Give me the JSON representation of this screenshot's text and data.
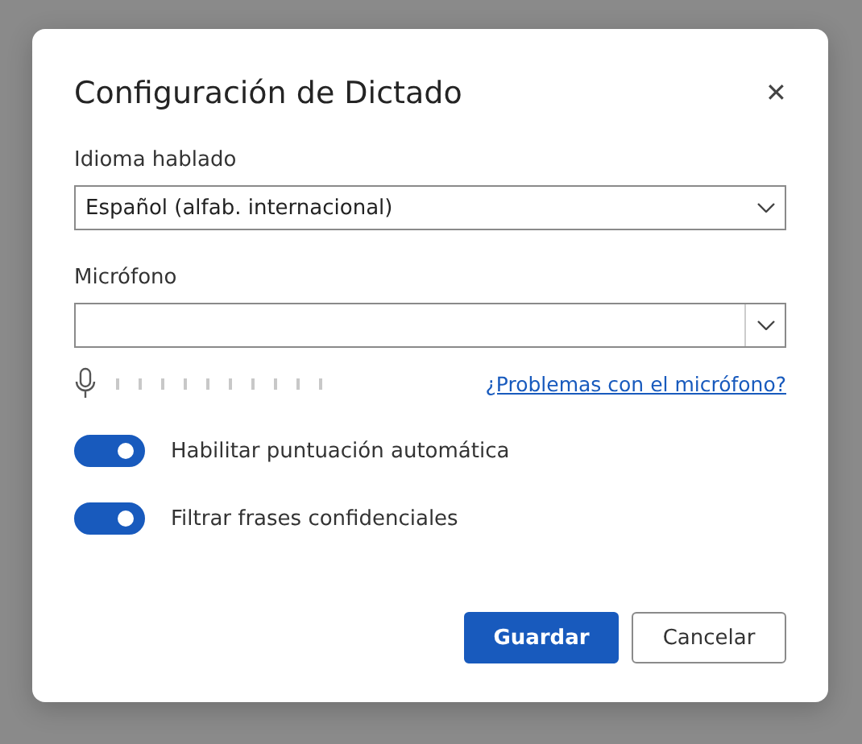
{
  "dialog": {
    "title": "Configuración de Dictado",
    "close": "✕"
  },
  "language": {
    "label": "Idioma hablado",
    "value": "Español (alfab. internacional)"
  },
  "microphone": {
    "label": "Micrófono"
  },
  "meter": {
    "link": "¿Problemas con el micrófono?"
  },
  "toggles": [
    {
      "label": "Habilitar puntuación automática",
      "on": true
    },
    {
      "label": "Filtrar frases confidenciales",
      "on": true
    }
  ],
  "buttons": [
    {
      "label": "Guardar",
      "kind": "primary"
    },
    {
      "label": "Cancelar",
      "kind": "secondary"
    }
  ]
}
